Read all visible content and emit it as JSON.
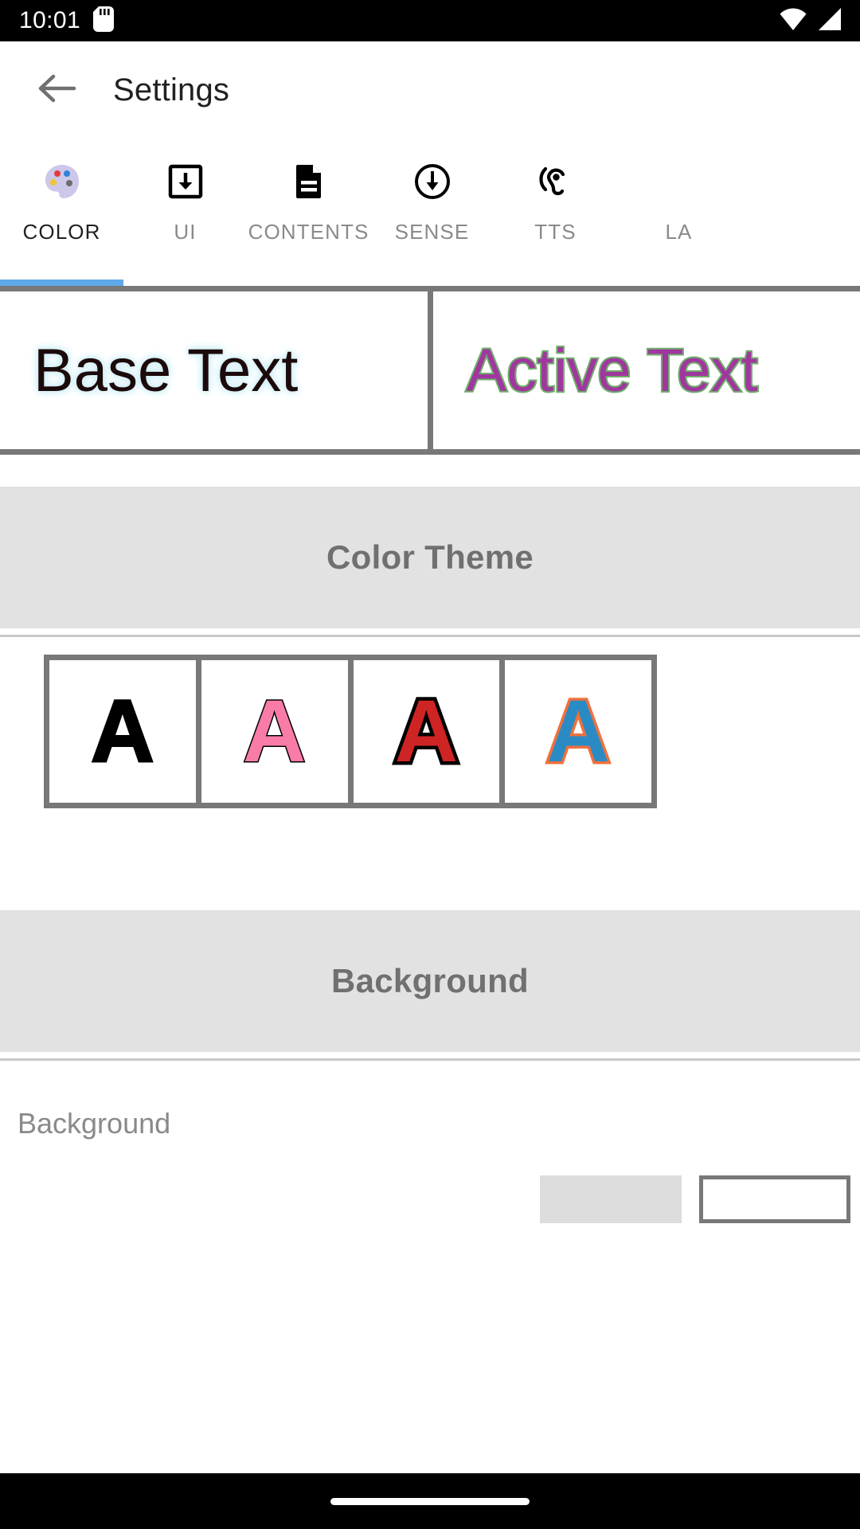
{
  "status_bar": {
    "clock": "10:01",
    "icons": [
      "sd-card-icon",
      "wifi-icon",
      "cellular-signal-icon"
    ]
  },
  "app_bar": {
    "back_icon": "back-arrow-icon",
    "title": "Settings"
  },
  "tabs": {
    "active_index": 0,
    "items": [
      {
        "label": "COLOR",
        "icon": "palette-icon"
      },
      {
        "label": "UI",
        "icon": "download-box-icon"
      },
      {
        "label": "CONTENTS",
        "icon": "document-icon"
      },
      {
        "label": "SENSE",
        "icon": "circle-down-arrow-icon"
      },
      {
        "label": "TTS",
        "icon": "hearing-ear-icon"
      },
      {
        "label": "LA",
        "icon": "language-icon"
      }
    ]
  },
  "preview": {
    "base": {
      "text": "Base Text",
      "color": "#1c0a0a",
      "glow": "#cdeef5"
    },
    "active": {
      "text": "Active Text",
      "color": "#a0379e",
      "outline": "#6fae6b"
    }
  },
  "color_theme": {
    "title": "Color Theme",
    "swatches": [
      {
        "glyph": "A",
        "fill": "#000000",
        "stroke": "#000000"
      },
      {
        "glyph": "A",
        "fill": "#f97ba8",
        "stroke": "#000000"
      },
      {
        "glyph": "A",
        "fill": "#cf2424",
        "stroke": "#000000"
      },
      {
        "glyph": "A",
        "fill": "#2a8bc4",
        "stroke": "#f0703c"
      }
    ]
  },
  "background_section": {
    "title": "Background",
    "label": "Background",
    "picker": {
      "selected_color": "#dddddd",
      "preview_color": "#ffffff"
    }
  },
  "nav_bar": {
    "home_indicator": "home-pill-indicator"
  },
  "theme": {
    "accent": "#5fa8e8",
    "band_bg": "#e2e2e2",
    "border_gray": "#787878",
    "muted_text": "#8a8a8a"
  }
}
